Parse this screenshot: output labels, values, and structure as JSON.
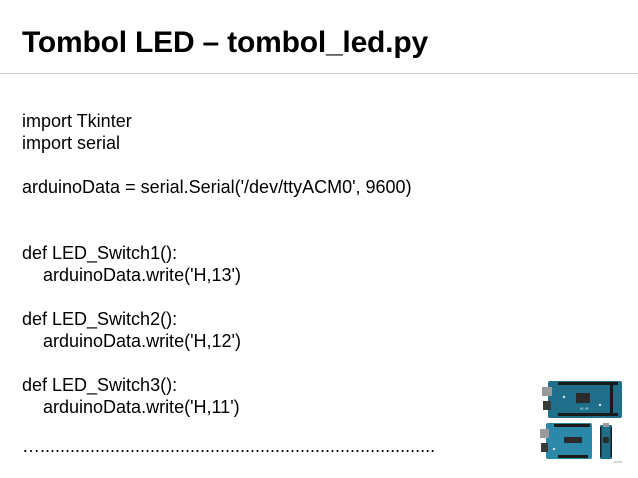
{
  "slide": {
    "title": "Tombol LED – tombol_led.py",
    "code_lines": [
      "import Tkinter",
      "import serial",
      "arduinoData = serial.Serial('/dev/ttyACM0', 9600)",
      "def LED_Switch1():",
      "arduinoData.write('H,13')",
      "def LED_Switch2():",
      "arduinoData.write('H,12')",
      "def LED_Switch3():",
      "arduinoData.write('H,11')"
    ],
    "ellipsis": "…...............................................................................",
    "image": {
      "description_icon": "arduino-boards-image",
      "colors": {
        "board": "#1f6f8b",
        "board_light": "#2c88a8",
        "pins": "#1a1a1a"
      }
    }
  }
}
